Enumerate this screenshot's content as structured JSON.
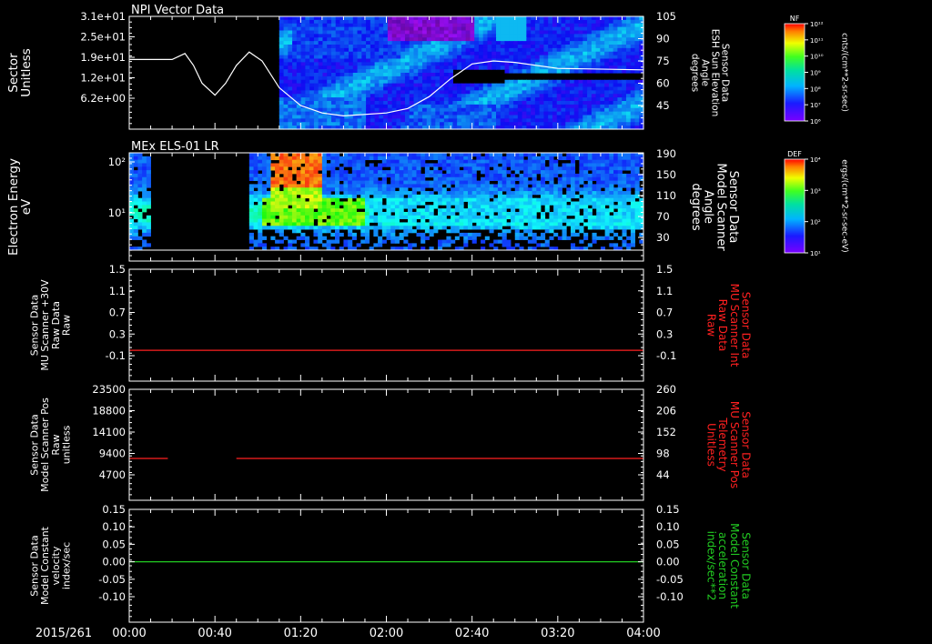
{
  "footer": {
    "date_label": "2015/261",
    "time_ticks": [
      "00:00",
      "00:40",
      "01:20",
      "02:00",
      "02:40",
      "03:20",
      "04:00"
    ]
  },
  "colors": {
    "background": "#000000",
    "red_trace": "#ff2020",
    "green_trace": "#22cc22",
    "white_trace": "#ffffff"
  },
  "colorbars": [
    {
      "id": "npi",
      "label": "NF",
      "units": "cnts/(cm**2-sr-sec)",
      "ticks": [
        "10¹²",
        "10¹¹",
        "10¹⁰",
        "10⁹",
        "10⁸",
        "10⁷",
        "10⁶"
      ]
    },
    {
      "id": "els",
      "label": "DEF",
      "units": "ergs/(cm**2-sr-sec-eV)",
      "ticks": [
        "10⁴",
        "10³",
        "10²",
        "10¹"
      ]
    }
  ],
  "chart_data": [
    {
      "type": "heatmap",
      "title": "NPI Vector Data",
      "ylabel": "Sector\nUnitless",
      "y_ticks": [
        "3.1e+01",
        "2.5e+01",
        "1.9e+01",
        "1.2e+01",
        "6.2e+00"
      ],
      "ylabel_right": "Sensor Data\nESH Sun Elevation\nAngle\ndegrees",
      "y_ticks_right": [
        "105",
        "90",
        "75",
        "60",
        "45"
      ],
      "xlim_minutes": [
        0,
        240
      ],
      "data_gap_minutes": [
        0,
        70
      ],
      "overlay_series": {
        "name": "ESH Sun Elevation Angle",
        "t_minutes": [
          0,
          20,
          26,
          30,
          34,
          40,
          45,
          50,
          56,
          62,
          70,
          80,
          90,
          100,
          120,
          130,
          140,
          150,
          160,
          170,
          180,
          200,
          240
        ],
        "values": [
          76,
          76,
          80,
          72,
          60,
          52,
          60,
          72,
          81,
          75,
          57,
          45,
          40,
          38,
          40,
          43,
          51,
          63,
          73,
          75,
          74,
          70,
          69,
          60,
          60
        ]
      }
    },
    {
      "type": "heatmap",
      "title": "MEx ELS-01 LR",
      "ylabel": "Electron Energy\neV",
      "y_ticks": [
        "10²",
        "10¹"
      ],
      "ylabel_right": "Sensor Data\nModel Scanner\nAngle\ndegrees",
      "y_ticks_right": [
        "190",
        "150",
        "110",
        "70",
        "30"
      ],
      "xlim_minutes": [
        0,
        240
      ],
      "data_gaps_minutes": [
        [
          10,
          56
        ]
      ],
      "hot_spot_minutes": [
        [
          65,
          90
        ]
      ]
    },
    {
      "type": "line",
      "ylabel": "Sensor Data\nMU Scanner +30V\nRaw Data\nRaw",
      "y_ticks": [
        "1.5",
        "1.1",
        "0.7",
        "0.3",
        "-0.1"
      ],
      "ylim": [
        -0.3,
        1.5
      ],
      "ylabel_right": "Sensor Data\nMU Scanner Int\nRaw Data\nRaw",
      "y_ticks_right": [
        "1.5",
        "1.1",
        "0.7",
        "0.3",
        "-0.1"
      ],
      "series": [
        {
          "t_minutes": [
            0,
            240
          ],
          "values": [
            0.0,
            0.0
          ]
        }
      ]
    },
    {
      "type": "line",
      "ylabel": "Sensor Data\nModel Scanner Pos\nRaw\nunitless",
      "y_ticks": [
        "23500",
        "18800",
        "14100",
        "9400",
        "4700"
      ],
      "ylim": [
        0,
        23500
      ],
      "ylabel_right": "Sensor Data\nMU Scanner Pos\nTelemetry\nUnitless",
      "y_ticks_right": [
        "260",
        "206",
        "152",
        "98",
        "44"
      ],
      "series": [
        {
          "t_minutes": [
            0,
            18
          ],
          "values": [
            8300,
            8300
          ]
        },
        {
          "t_minutes": [
            50,
            240
          ],
          "values": [
            8300,
            8300
          ]
        }
      ]
    },
    {
      "type": "line",
      "ylabel": "Sensor Data\nModel Constant\nvelocity\nindex/sec",
      "y_ticks": [
        "0.15",
        "0.10",
        "0.05",
        "0.00",
        "-0.05",
        "-0.10"
      ],
      "ylim": [
        -0.1,
        0.15
      ],
      "ylabel_right": "Sensor Data\nModel Constant\nacceleration\nindex/sec**2",
      "y_ticks_right": [
        "0.15",
        "0.10",
        "0.05",
        "0.00",
        "-0.05",
        "-0.10"
      ],
      "series": [
        {
          "t_minutes": [
            0,
            240
          ],
          "values": [
            0.0,
            0.0
          ]
        }
      ]
    }
  ]
}
